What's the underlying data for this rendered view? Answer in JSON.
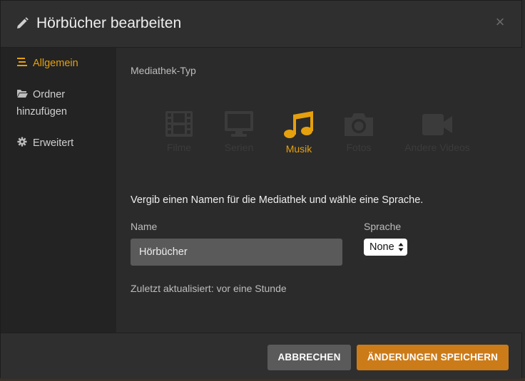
{
  "dialog": {
    "title": "Hörbücher bearbeiten",
    "close_label": "×"
  },
  "sidebar": {
    "items": [
      {
        "label": "Allgemein",
        "icon": "list-icon",
        "active": true
      },
      {
        "label": "Ordner",
        "label2": "hinzufügen",
        "icon": "folder-icon",
        "active": false
      },
      {
        "label": "Erweitert",
        "icon": "gear-icon",
        "active": false
      }
    ]
  },
  "library_type": {
    "label": "Mediathek-Typ",
    "types": [
      {
        "label": "Filme",
        "icon": "film-icon"
      },
      {
        "label": "Serien",
        "icon": "tv-icon"
      },
      {
        "label": "Musik",
        "icon": "music-icon",
        "selected": true
      },
      {
        "label": "Fotos",
        "icon": "camera-icon"
      },
      {
        "label": "Andere Videos",
        "icon": "video-camera-icon"
      }
    ]
  },
  "form": {
    "prompt": "Vergib einen Namen für die Mediathek und wähle eine Sprache.",
    "name_label": "Name",
    "name_value": "Hörbücher",
    "language_label": "Sprache",
    "language_value": "None",
    "updated_text": "Zuletzt aktualisiert: vor eine Stunde"
  },
  "footer": {
    "cancel_label": "ABBRECHEN",
    "save_label": "ÄNDERUNGEN SPEICHERN"
  },
  "colors": {
    "accent": "#e5a00d",
    "save_button": "#cc7b19",
    "cancel_button": "#5a5a5a"
  }
}
